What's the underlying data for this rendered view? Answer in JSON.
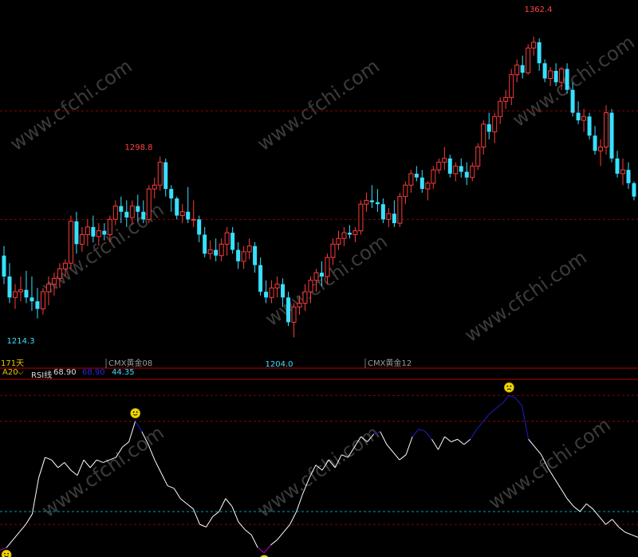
{
  "colors": {
    "up": "#ff3b3b",
    "down": "#38e0ff",
    "grid": "#8b0000",
    "rsi_line": "#ffffff",
    "rsi_high": "#1e1ec8",
    "rsi_low": "#c000c0",
    "mid_dash": "#00a0a0",
    "panel_border": "#c00000"
  },
  "watermark": "www.cfchi.com",
  "price_panel": {
    "ylim": [
      1195,
      1372
    ],
    "labels": {
      "high": "1362.4",
      "peak1": "1298.8",
      "low1": "1214.3",
      "low2": "1204.0"
    },
    "contracts": {
      "left": "CMX黄金08",
      "right": "CMX黄金12"
    },
    "day_count": "171天"
  },
  "indicator_panel": {
    "name": "A20",
    "line_name": "RSI线",
    "value": "68.90",
    "value_high": "68.90",
    "value2": "44.35",
    "ylim": [
      18,
      85
    ]
  },
  "chart_data": [
    {
      "type": "candlestick",
      "title": "",
      "series": [
        {
          "name": "",
          "ohlc": [
            [
              1247,
              1252,
              1232,
              1236
            ],
            [
              1236,
              1243,
              1222,
              1225
            ],
            [
              1225,
              1232,
              1219,
              1228
            ],
            [
              1228,
              1236,
              1223,
              1229
            ],
            [
              1229,
              1239,
              1222,
              1225
            ],
            [
              1225,
              1236,
              1218,
              1223
            ],
            [
              1223,
              1230,
              1214,
              1219
            ],
            [
              1219,
              1230,
              1216,
              1228
            ],
            [
              1228,
              1236,
              1221,
              1232
            ],
            [
              1232,
              1238,
              1226,
              1235
            ],
            [
              1235,
              1243,
              1230,
              1240
            ],
            [
              1240,
              1245,
              1236,
              1243
            ],
            [
              1243,
              1268,
              1240,
              1265
            ],
            [
              1265,
              1270,
              1248,
              1253
            ],
            [
              1253,
              1262,
              1249,
              1258
            ],
            [
              1258,
              1266,
              1252,
              1262
            ],
            [
              1262,
              1268,
              1254,
              1257
            ],
            [
              1257,
              1264,
              1252,
              1260
            ],
            [
              1260,
              1264,
              1255,
              1258
            ],
            [
              1258,
              1268,
              1254,
              1266
            ],
            [
              1266,
              1276,
              1263,
              1273
            ],
            [
              1273,
              1278,
              1264,
              1270
            ],
            [
              1270,
              1276,
              1262,
              1267
            ],
            [
              1267,
              1276,
              1263,
              1273
            ],
            [
              1273,
              1279,
              1265,
              1270
            ],
            [
              1270,
              1276,
              1264,
              1266
            ],
            [
              1266,
              1284,
              1264,
              1282
            ],
            [
              1282,
              1288,
              1277,
              1284
            ],
            [
              1284,
              1299,
              1281,
              1296
            ],
            [
              1296,
              1298,
              1278,
              1282
            ],
            [
              1282,
              1284,
              1270,
              1277
            ],
            [
              1277,
              1278,
              1266,
              1268
            ],
            [
              1268,
              1274,
              1264,
              1270
            ],
            [
              1270,
              1283,
              1264,
              1266
            ],
            [
              1266,
              1276,
              1262,
              1266
            ],
            [
              1266,
              1268,
              1254,
              1258
            ],
            [
              1258,
              1262,
              1246,
              1248
            ],
            [
              1248,
              1255,
              1245,
              1250
            ],
            [
              1250,
              1256,
              1244,
              1247
            ],
            [
              1247,
              1256,
              1244,
              1253
            ],
            [
              1253,
              1262,
              1247,
              1259
            ],
            [
              1259,
              1262,
              1248,
              1250
            ],
            [
              1250,
              1254,
              1240,
              1244
            ],
            [
              1244,
              1252,
              1240,
              1249
            ],
            [
              1249,
              1256,
              1245,
              1252
            ],
            [
              1252,
              1254,
              1238,
              1242
            ],
            [
              1242,
              1246,
              1226,
              1228
            ],
            [
              1228,
              1234,
              1222,
              1225
            ],
            [
              1225,
              1234,
              1222,
              1230
            ],
            [
              1230,
              1236,
              1225,
              1232
            ],
            [
              1232,
              1235,
              1220,
              1225
            ],
            [
              1225,
              1228,
              1210,
              1212
            ],
            [
              1212,
              1222,
              1204,
              1220
            ],
            [
              1220,
              1226,
              1216,
              1222
            ],
            [
              1222,
              1232,
              1218,
              1228
            ],
            [
              1228,
              1236,
              1222,
              1234
            ],
            [
              1234,
              1240,
              1228,
              1238
            ],
            [
              1238,
              1244,
              1231,
              1236
            ],
            [
              1236,
              1248,
              1232,
              1246
            ],
            [
              1246,
              1256,
              1242,
              1253
            ],
            [
              1253,
              1260,
              1250,
              1256
            ],
            [
              1256,
              1262,
              1252,
              1259
            ],
            [
              1259,
              1263,
              1256,
              1258
            ],
            [
              1258,
              1262,
              1254,
              1260
            ],
            [
              1260,
              1276,
              1258,
              1274
            ],
            [
              1274,
              1280,
              1270,
              1276
            ],
            [
              1276,
              1284,
              1272,
              1275
            ],
            [
              1275,
              1282,
              1270,
              1274
            ],
            [
              1274,
              1277,
              1264,
              1266
            ],
            [
              1266,
              1272,
              1262,
              1269
            ],
            [
              1269,
              1276,
              1262,
              1264
            ],
            [
              1264,
              1280,
              1262,
              1278
            ],
            [
              1278,
              1286,
              1274,
              1284
            ],
            [
              1284,
              1292,
              1280,
              1290
            ],
            [
              1290,
              1294,
              1286,
              1288
            ],
            [
              1288,
              1292,
              1280,
              1282
            ],
            [
              1282,
              1286,
              1276,
              1285
            ],
            [
              1285,
              1294,
              1282,
              1292
            ],
            [
              1292,
              1298,
              1290,
              1296
            ],
            [
              1296,
              1304,
              1292,
              1298
            ],
            [
              1298,
              1300,
              1288,
              1290
            ],
            [
              1290,
              1296,
              1286,
              1294
            ],
            [
              1294,
              1298,
              1288,
              1291
            ],
            [
              1291,
              1296,
              1284,
              1288
            ],
            [
              1288,
              1296,
              1286,
              1294
            ],
            [
              1294,
              1306,
              1292,
              1304
            ],
            [
              1304,
              1318,
              1300,
              1316
            ],
            [
              1316,
              1322,
              1308,
              1312
            ],
            [
              1312,
              1322,
              1306,
              1320
            ],
            [
              1320,
              1330,
              1316,
              1328
            ],
            [
              1328,
              1334,
              1324,
              1330
            ],
            [
              1330,
              1345,
              1326,
              1342
            ],
            [
              1342,
              1350,
              1338,
              1347
            ],
            [
              1347,
              1352,
              1340,
              1343
            ],
            [
              1343,
              1358,
              1342,
              1356
            ],
            [
              1356,
              1362,
              1352,
              1359
            ],
            [
              1359,
              1361,
              1344,
              1348
            ],
            [
              1348,
              1350,
              1338,
              1340
            ],
            [
              1340,
              1346,
              1336,
              1344
            ],
            [
              1344,
              1348,
              1336,
              1338
            ],
            [
              1338,
              1346,
              1334,
              1345
            ],
            [
              1345,
              1348,
              1332,
              1334
            ],
            [
              1334,
              1338,
              1320,
              1322
            ],
            [
              1322,
              1328,
              1316,
              1318
            ],
            [
              1318,
              1324,
              1312,
              1320
            ],
            [
              1320,
              1322,
              1308,
              1310
            ],
            [
              1310,
              1315,
              1300,
              1302
            ],
            [
              1302,
              1308,
              1294,
              1304
            ],
            [
              1304,
              1326,
              1300,
              1322
            ],
            [
              1322,
              1324,
              1296,
              1298
            ],
            [
              1298,
              1302,
              1288,
              1290
            ],
            [
              1290,
              1298,
              1284,
              1292
            ],
            [
              1292,
              1296,
              1282,
              1285
            ],
            [
              1285,
              1286,
              1276,
              1278
            ]
          ]
        }
      ]
    },
    {
      "type": "line",
      "title": "",
      "ylim": [
        18,
        85
      ],
      "series": [
        {
          "name": "RSI线",
          "values": [
            20,
            21,
            24,
            27,
            30,
            34,
            48,
            56,
            55,
            52,
            54,
            51,
            49,
            55,
            52,
            55,
            54,
            55,
            56,
            60,
            62,
            70,
            66,
            61,
            55,
            50,
            45,
            44,
            40,
            38,
            36,
            30,
            29,
            33,
            35,
            40,
            37,
            31,
            28,
            26,
            21,
            19,
            22,
            24,
            27,
            30,
            35,
            42,
            48,
            53,
            51,
            55,
            52,
            57,
            56,
            60,
            64,
            62,
            65,
            66,
            61,
            58,
            55,
            57,
            64,
            67,
            66,
            63,
            59,
            64,
            62,
            63,
            61,
            63,
            67,
            70,
            73,
            75,
            77,
            80,
            79,
            76,
            63,
            60,
            57,
            52,
            48,
            44,
            40,
            37,
            35,
            38,
            36,
            33,
            30,
            32,
            29,
            27,
            26,
            25
          ]
        }
      ]
    }
  ]
}
